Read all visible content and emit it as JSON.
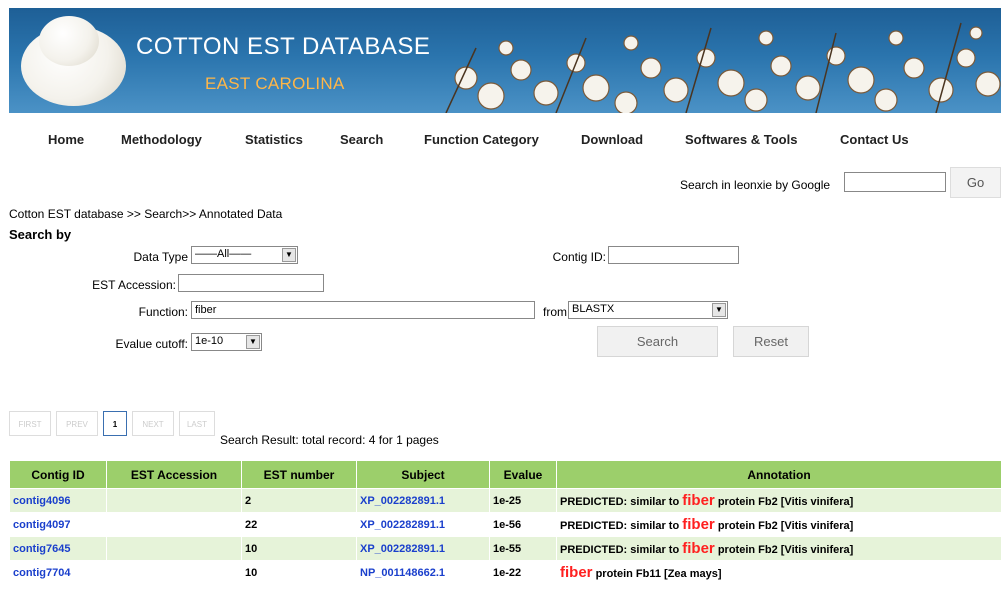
{
  "banner": {
    "title": "COTTON  EST  DATABASE",
    "subtitle": "EAST CAROLINA"
  },
  "nav": [
    "Home",
    "Methodology",
    "Statistics",
    "Search",
    "Function Category",
    "Download",
    "Softwares & Tools",
    "Contact Us"
  ],
  "google": {
    "label": "Search in leonxie by Google",
    "value": "",
    "button": "Go"
  },
  "breadcrumb": "Cotton EST database >> Search>> Annotated Data",
  "search_by": "Search by",
  "form": {
    "data_type_label": "Data Type",
    "data_type_value": "——All——",
    "contig_id_label": "Contig ID:",
    "contig_id_value": "",
    "est_accession_label": "EST Accession:",
    "est_accession_value": "",
    "function_label": "Function:",
    "function_value": "fiber",
    "from_label": "from",
    "from_value": "BLASTX",
    "evalue_label": "Evalue cutoff:",
    "evalue_value": "1e-10",
    "search_button": "Search",
    "reset_button": "Reset"
  },
  "pager": {
    "first": "FIRST",
    "prev": "PREV",
    "current": "1",
    "next": "NEXT",
    "last": "LAST"
  },
  "result_summary": "Search Result: total record: 4    for 1 pages",
  "table": {
    "headers": [
      "Contig ID",
      "EST Accession",
      "EST number",
      "Subject",
      "Evalue",
      "Annotation"
    ],
    "rows": [
      {
        "contig": "contig4096",
        "accession": "",
        "number": "2",
        "subject": "XP_002282891.1",
        "evalue": "1e-25",
        "pre": "PREDICTED: similar to ",
        "hl": "fiber",
        "post": " protein Fb2 [Vitis vinifera]"
      },
      {
        "contig": "contig4097",
        "accession": "",
        "number": "22",
        "subject": "XP_002282891.1",
        "evalue": "1e-56",
        "pre": "PREDICTED: similar to ",
        "hl": "fiber",
        "post": " protein Fb2 [Vitis vinifera]"
      },
      {
        "contig": "contig7645",
        "accession": "",
        "number": "10",
        "subject": "XP_002282891.1",
        "evalue": "1e-55",
        "pre": "PREDICTED: similar to ",
        "hl": "fiber",
        "post": " protein Fb2 [Vitis vinifera]"
      },
      {
        "contig": "contig7704",
        "accession": "",
        "number": "10",
        "subject": "NP_001148662.1",
        "evalue": "1e-22",
        "pre": "",
        "hl": "fiber",
        "post": " protein Fb11 [Zea mays]"
      }
    ]
  },
  "colors": {
    "banner_blue": "#2a74ad",
    "subtitle_orange": "#ffb648",
    "header_green": "#9ccf6b",
    "row_green": "#e6f3d9",
    "link_blue": "#1a3fcc",
    "highlight_red": "#ff2020"
  }
}
